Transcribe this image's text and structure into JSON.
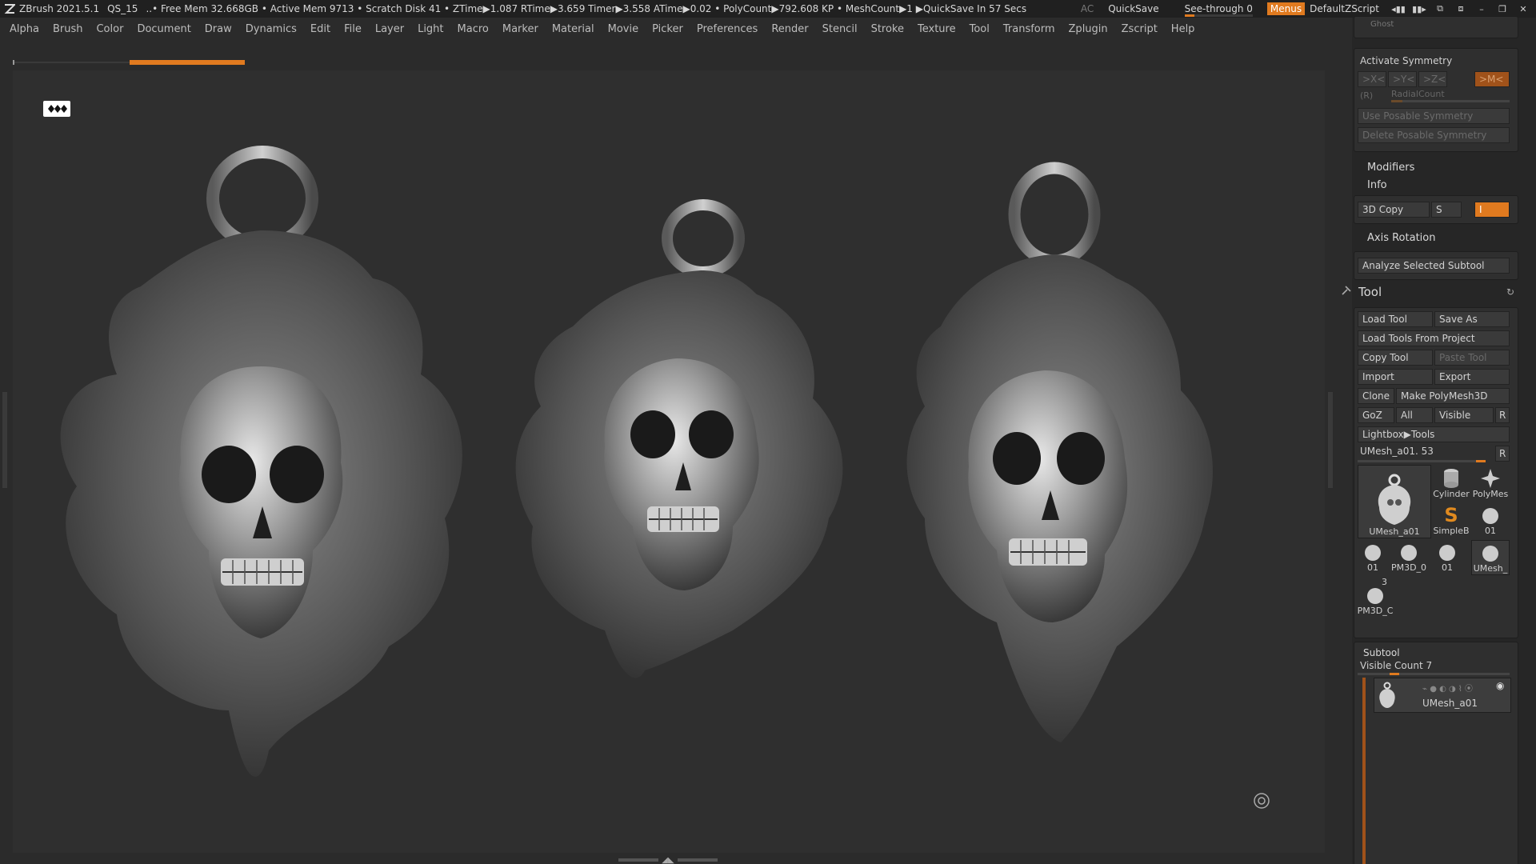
{
  "titlebar": {
    "app": "ZBrush 2021.5.1",
    "project": "QS_15",
    "stats": "..• Free Mem 32.668GB • Active Mem 9713 • Scratch Disk 41 •  ZTime▶1.087 RTime▶3.659 Timer▶3.558 ATime▶0.02 • PolyCount▶792.608 KP  • MeshCount▶1  ▶QuickSave In 57 Secs",
    "ac": "AC",
    "quicksave": "QuickSave",
    "see_through": "See-through  0",
    "menus": "Menus",
    "script": "DefaultZScript"
  },
  "menubar": [
    "Alpha",
    "Brush",
    "Color",
    "Document",
    "Draw",
    "Dynamics",
    "Edit",
    "File",
    "Layer",
    "Light",
    "Macro",
    "Marker",
    "Material",
    "Movie",
    "Picker",
    "Preferences",
    "Render",
    "Stencil",
    "Stroke",
    "Texture",
    "Tool",
    "Transform",
    "Zplugin",
    "Zscript",
    "Help"
  ],
  "symmetry": {
    "ghost": "Ghost",
    "activate": "Activate Symmetry",
    "x": ">X<",
    "y": ">Y<",
    "z": ">Z<",
    "m": ">M<",
    "r": "(R)",
    "radial": "RadialCount",
    "use_posable": "Use Posable Symmetry",
    "delete_posable": "Delete Posable Symmetry"
  },
  "modifiers": {
    "title": "Modifiers",
    "info": "Info",
    "copy3d": "3D Copy",
    "s": "S",
    "i": "I",
    "axis_rotation": "Axis Rotation",
    "analyze": "Analyze Selected Subtool"
  },
  "tool": {
    "title": "Tool",
    "load_tool": "Load Tool",
    "save_as": "Save As",
    "load_from_project": "Load Tools From Project",
    "copy_tool": "Copy Tool",
    "paste_tool": "Paste Tool",
    "import": "Import",
    "export": "Export",
    "clone": "Clone",
    "make_polymesh": "Make PolyMesh3D",
    "goz": "GoZ",
    "all": "All",
    "visible": "Visible",
    "r": "R",
    "lightbox": "Lightbox▶Tools",
    "current_tool": "UMesh_a01. 53",
    "current_r": "R",
    "thumbs": {
      "main": "UMesh_a01",
      "cylinder": "Cylinder",
      "polymesh": "PolyMes",
      "simpleb": "SimpleB",
      "t01a": "01",
      "t01b": "01",
      "pm3d0": "PM3D_0",
      "t01c": "01",
      "umesh": "UMesh_",
      "num3": "3",
      "pm3dc": "PM3D_C"
    }
  },
  "subtool": {
    "title": "Subtool",
    "visible_count": "Visible Count 7",
    "item": "UMesh_a01"
  }
}
